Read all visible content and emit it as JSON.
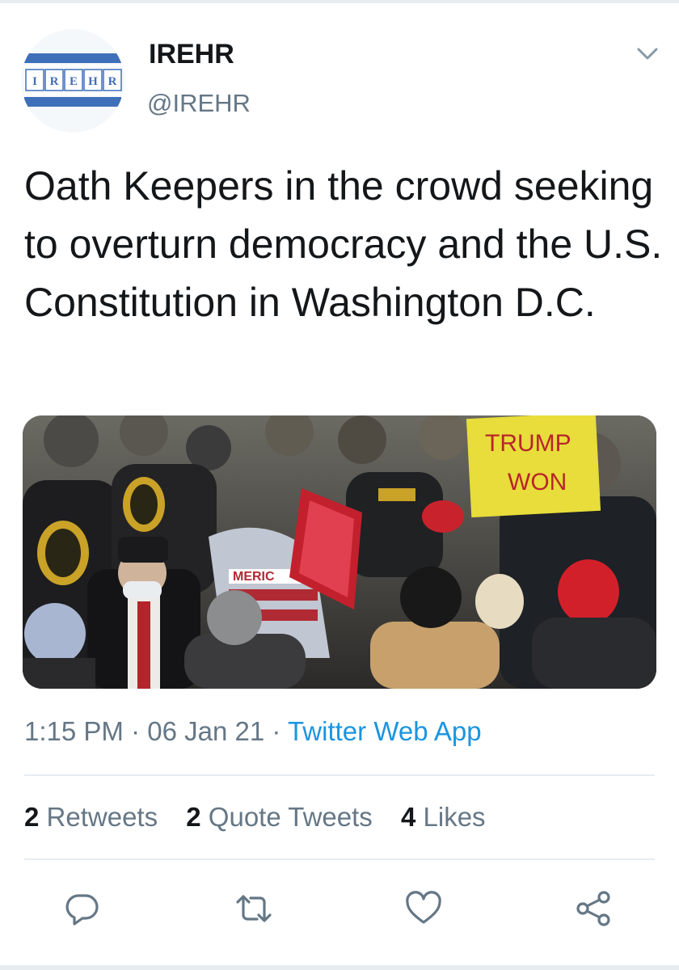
{
  "author": {
    "display_name": "IREHR",
    "handle": "@IREHR",
    "avatar_logo_letters": [
      "I",
      "R",
      "E",
      "H",
      "R"
    ],
    "brand_color": "#3f6fb8"
  },
  "tweet": {
    "text": "Oath Keepers in the crowd seeking to overturn democracy and the U.S. Constitution in Washington D.C.",
    "time": "1:15 PM",
    "date": "06 Jan 21",
    "source": "Twitter Web App",
    "separator": "·"
  },
  "media": {
    "sign_text_line1": "TRUMP",
    "sign_text_line2": "WON",
    "flag_text": "MERIC"
  },
  "stats": {
    "retweets_count": "2",
    "retweets_label": "Retweets",
    "quotes_count": "2",
    "quotes_label": "Quote Tweets",
    "likes_count": "4",
    "likes_label": "Likes"
  },
  "actions": {
    "reply_icon": "reply-icon",
    "retweet_icon": "retweet-icon",
    "like_icon": "heart-icon",
    "share_icon": "share-icon",
    "icon_color": "#657786"
  }
}
